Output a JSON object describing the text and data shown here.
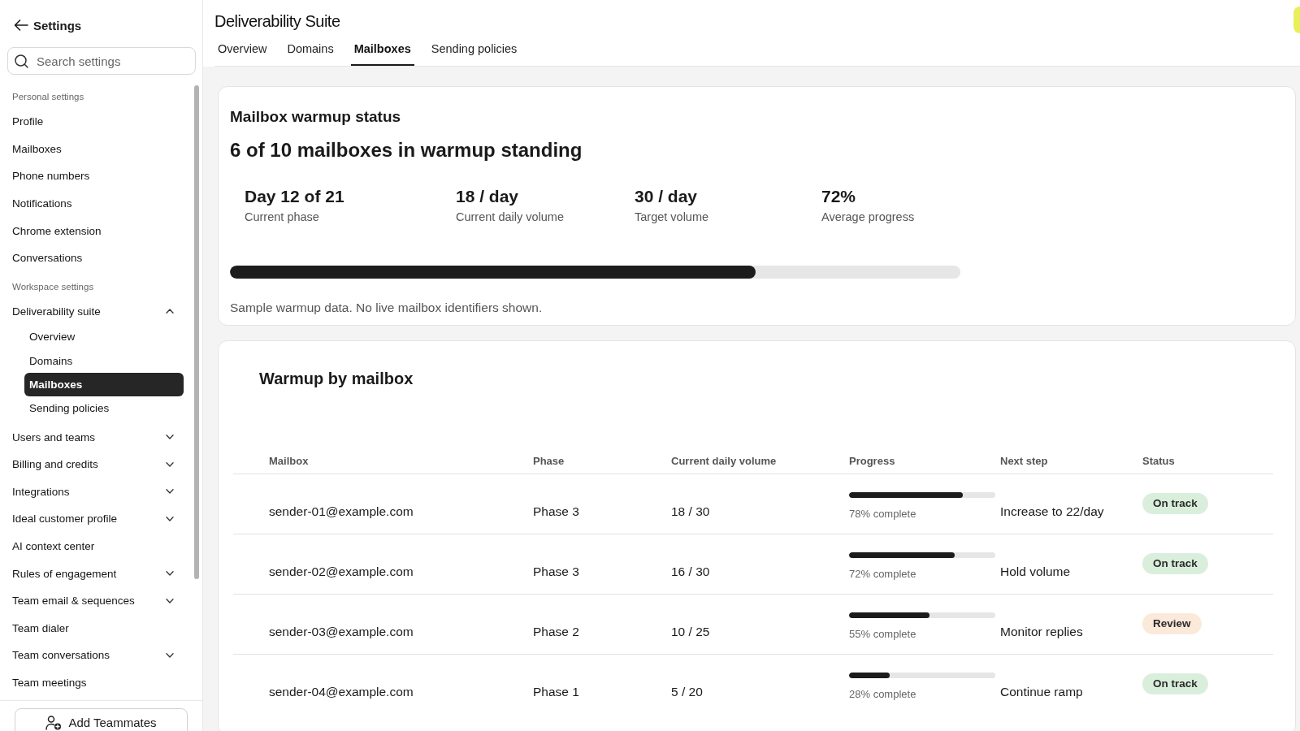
{
  "sidebar": {
    "back_link": "Settings",
    "search": {
      "placeholder": "Search settings"
    },
    "sections": [
      {
        "heading": "Personal settings",
        "items": [
          {
            "label": "Profile",
            "kind": "link",
            "selected": false
          },
          {
            "label": "Mailboxes",
            "kind": "link",
            "selected": false
          },
          {
            "label": "Phone numbers",
            "kind": "link",
            "selected": false
          },
          {
            "label": "Notifications",
            "kind": "link",
            "selected": false
          },
          {
            "label": "Chrome extension",
            "kind": "link",
            "selected": false
          },
          {
            "label": "Conversations",
            "kind": "link",
            "selected": false
          }
        ]
      },
      {
        "heading": "Workspace settings",
        "items": [
          {
            "label": "Deliverability suite",
            "kind": "group",
            "expanded": true,
            "selected": false,
            "children": [
              {
                "label": "Overview",
                "selected": false
              },
              {
                "label": "Domains",
                "selected": false
              },
              {
                "label": "Mailboxes",
                "selected": true
              },
              {
                "label": "Sending policies",
                "selected": false
              }
            ]
          },
          {
            "label": "Users and teams",
            "kind": "group",
            "expanded": false,
            "selected": false
          },
          {
            "label": "Billing and credits",
            "kind": "group",
            "expanded": false,
            "selected": false
          },
          {
            "label": "Integrations",
            "kind": "group",
            "expanded": false,
            "selected": false
          },
          {
            "label": "Ideal customer profile",
            "kind": "group",
            "expanded": false,
            "selected": false
          },
          {
            "label": "AI context center",
            "kind": "link",
            "selected": false
          },
          {
            "label": "Rules of engagement",
            "kind": "group",
            "expanded": false,
            "selected": false
          },
          {
            "label": "Team email & sequences",
            "kind": "group",
            "expanded": false,
            "selected": false
          },
          {
            "label": "Team dialer",
            "kind": "link",
            "selected": false
          },
          {
            "label": "Team conversations",
            "kind": "group",
            "expanded": false,
            "selected": false
          },
          {
            "label": "Team meetings",
            "kind": "link",
            "selected": false
          }
        ]
      }
    ],
    "footer_button": "Add Teammates"
  },
  "header": {
    "title": "Deliverability Suite",
    "tabs": [
      {
        "label": "Overview",
        "selected": false
      },
      {
        "label": "Domains",
        "selected": false
      },
      {
        "label": "Mailboxes",
        "selected": true
      },
      {
        "label": "Sending policies",
        "selected": false
      }
    ]
  },
  "warmup_status": {
    "title": "Mailbox warmup status",
    "headline": "6 of 10 mailboxes in warmup standing",
    "stats": [
      {
        "value": "Day 12 of 21",
        "label": "Current phase"
      },
      {
        "value": "18 / day",
        "label": "Current daily volume"
      },
      {
        "value": "30 / day",
        "label": "Target volume"
      },
      {
        "value": "72%",
        "label": "Average progress"
      }
    ],
    "progress": {
      "level": 0.72
    },
    "note": "Sample warmup data. No live mailbox identifiers shown."
  },
  "mailbox_table": {
    "title": "Warmup by mailbox",
    "columns": [
      "Mailbox",
      "Phase",
      "Current daily volume",
      "Progress",
      "Next step",
      "Status"
    ],
    "rows": [
      {
        "mailbox": "sender-01@example.com",
        "phase": "Phase 3",
        "volume": "18 / 30",
        "progress": {
          "level": 0.78,
          "reading": "78% complete"
        },
        "next_step": "Increase to 22/day",
        "status": {
          "label": "On track",
          "color": "#d9efdc"
        }
      },
      {
        "mailbox": "sender-02@example.com",
        "phase": "Phase 3",
        "volume": "16 / 30",
        "progress": {
          "level": 0.72,
          "reading": "72% complete"
        },
        "next_step": "Hold volume",
        "status": {
          "label": "On track",
          "color": "#d9efdc"
        }
      },
      {
        "mailbox": "sender-03@example.com",
        "phase": "Phase 2",
        "volume": "10 / 25",
        "progress": {
          "level": 0.55,
          "reading": "55% complete"
        },
        "next_step": "Monitor replies",
        "status": {
          "label": "Review",
          "color": "#fbe9da"
        }
      },
      {
        "mailbox": "sender-04@example.com",
        "phase": "Phase 1",
        "volume": "5 / 20",
        "progress": {
          "level": 0.28,
          "reading": "28% complete"
        },
        "next_step": "Continue ramp",
        "status": {
          "label": "On track",
          "color": "#d9efdc"
        }
      }
    ]
  }
}
